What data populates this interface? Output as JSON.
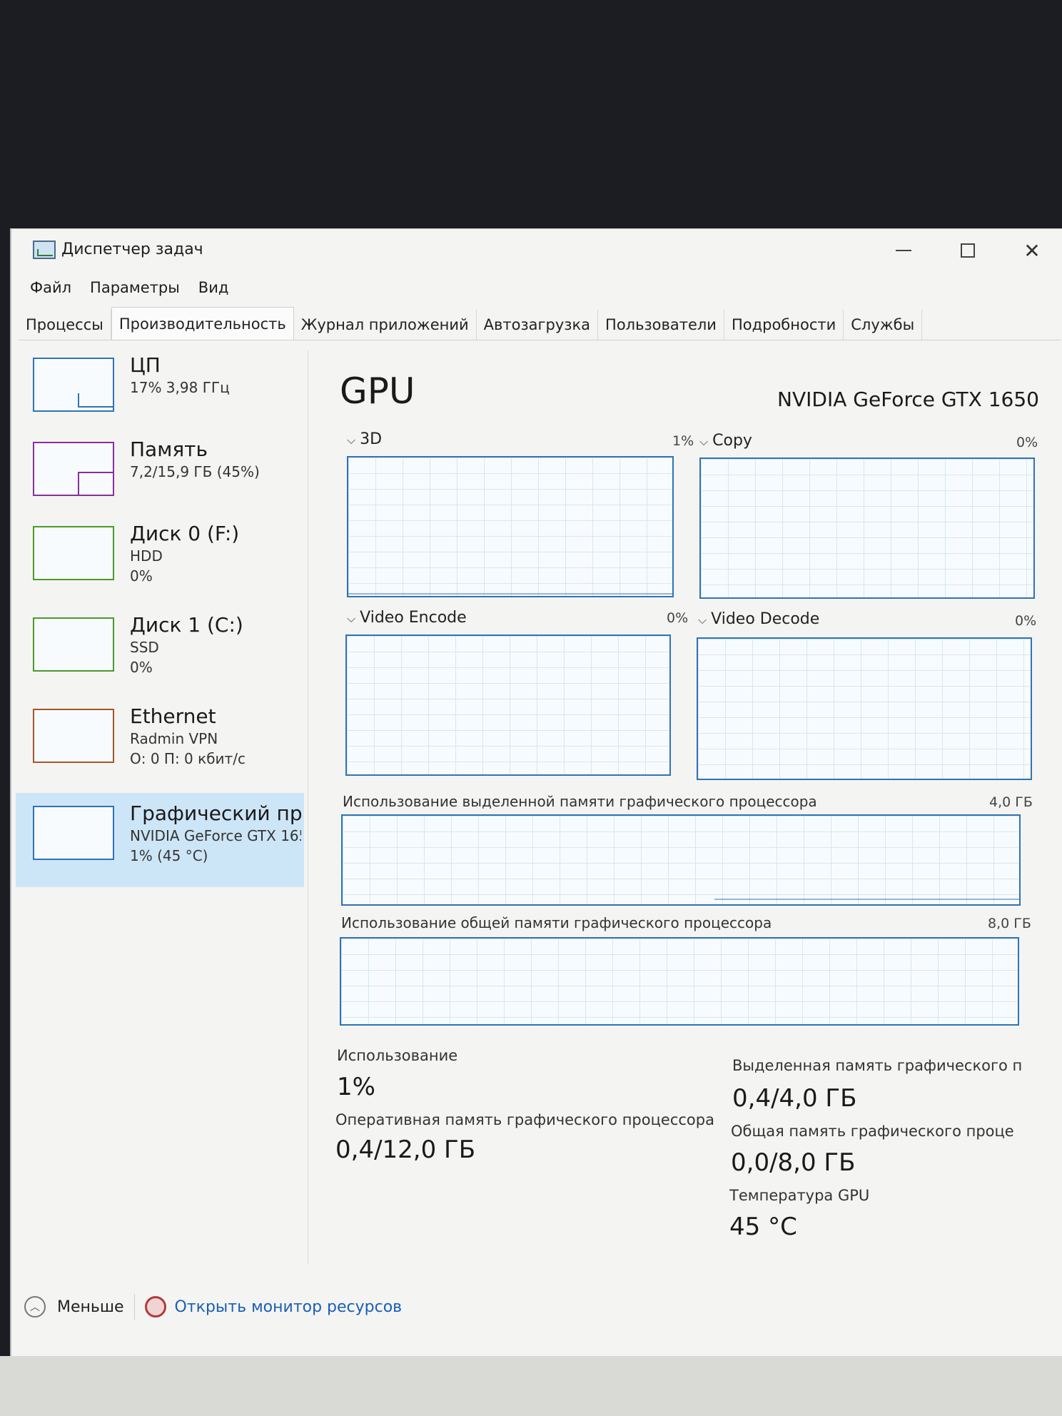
{
  "window": {
    "title": "Диспетчер задач"
  },
  "menu": {
    "items": [
      "Файл",
      "Параметры",
      "Вид"
    ]
  },
  "tabs": [
    "Процессы",
    "Производительность",
    "Журнал приложений",
    "Автозагрузка",
    "Пользователи",
    "Подробности",
    "Службы"
  ],
  "active_tab": "Производительность",
  "sidebar": {
    "items": [
      {
        "title": "ЦП",
        "sub1": "17% 3,98 ГГц",
        "sub2": ""
      },
      {
        "title": "Память",
        "sub1": "7,2/15,9 ГБ (45%)",
        "sub2": ""
      },
      {
        "title": "Диск 0 (F:)",
        "sub1": "HDD",
        "sub2": "0%"
      },
      {
        "title": "Диск 1 (C:)",
        "sub1": "SSD",
        "sub2": "0%"
      },
      {
        "title": "Ethernet",
        "sub1": "Radmin VPN",
        "sub2": "О: 0 П: 0 кбит/с"
      },
      {
        "title": "Графический про",
        "sub1": "NVIDIA GeForce GTX 165",
        "sub2": "1% (45 °C)"
      }
    ]
  },
  "main": {
    "title": "GPU",
    "model": "NVIDIA GeForce GTX 1650",
    "graphs": [
      {
        "label": "3D",
        "pct": "1%"
      },
      {
        "label": "Copy",
        "pct": "0%"
      },
      {
        "label": "Video Encode",
        "pct": "0%"
      },
      {
        "label": "Video Decode",
        "pct": "0%"
      }
    ],
    "dedicated_label": "Использование выделенной памяти графического процессора",
    "dedicated_cap": "4,0 ГБ",
    "shared_label": "Использование общей памяти графического процессора",
    "shared_cap": "8,0 ГБ",
    "stats": {
      "usage_label": "Использование",
      "usage_value": "1%",
      "gpu_ram_label": "Оперативная память графического процессора",
      "gpu_ram_value": "0,4/12,0 ГБ",
      "dedicated_label": "Выделенная память графического п",
      "dedicated_value": "0,4/4,0 ГБ",
      "shared_label": "Общая память графического проце",
      "shared_value": "0,0/8,0 ГБ",
      "temp_label": "Температура GPU",
      "temp_value": "45 °C"
    }
  },
  "footer": {
    "less": "Меньше",
    "resource_monitor": "Открыть монитор ресурсов"
  }
}
